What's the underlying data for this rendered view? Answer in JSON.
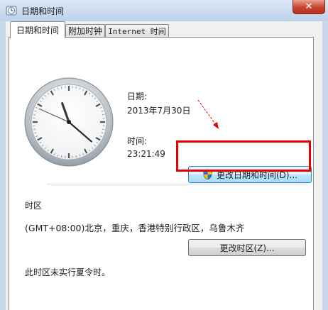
{
  "window": {
    "title": "日期和时间",
    "close_glyph": "✕"
  },
  "tabs": [
    {
      "label": "日期和时间",
      "active": true
    },
    {
      "label": "附加时钟",
      "active": false
    },
    {
      "label": "Internet 时间",
      "active": false
    }
  ],
  "date_time": {
    "date_label": "日期:",
    "date_value": "2013年7月30日",
    "time_label": "时间:",
    "time_value": "23:21:49",
    "change_button": "更改日期和时间(D)..."
  },
  "clock": {
    "hour": 23,
    "minute": 21,
    "second": 49
  },
  "timezone": {
    "section_label": "时区",
    "value": "(GMT+08:00)北京，重庆，香港特别行政区，乌鲁木齐",
    "change_button": "更改时区(Z)...",
    "dst_note": "此时区未实行夏令时。"
  },
  "icons": {
    "window": "clock-icon",
    "shield": "uac-shield-icon"
  },
  "colors": {
    "highlight": "#e30000",
    "arrow": "#e30000"
  }
}
